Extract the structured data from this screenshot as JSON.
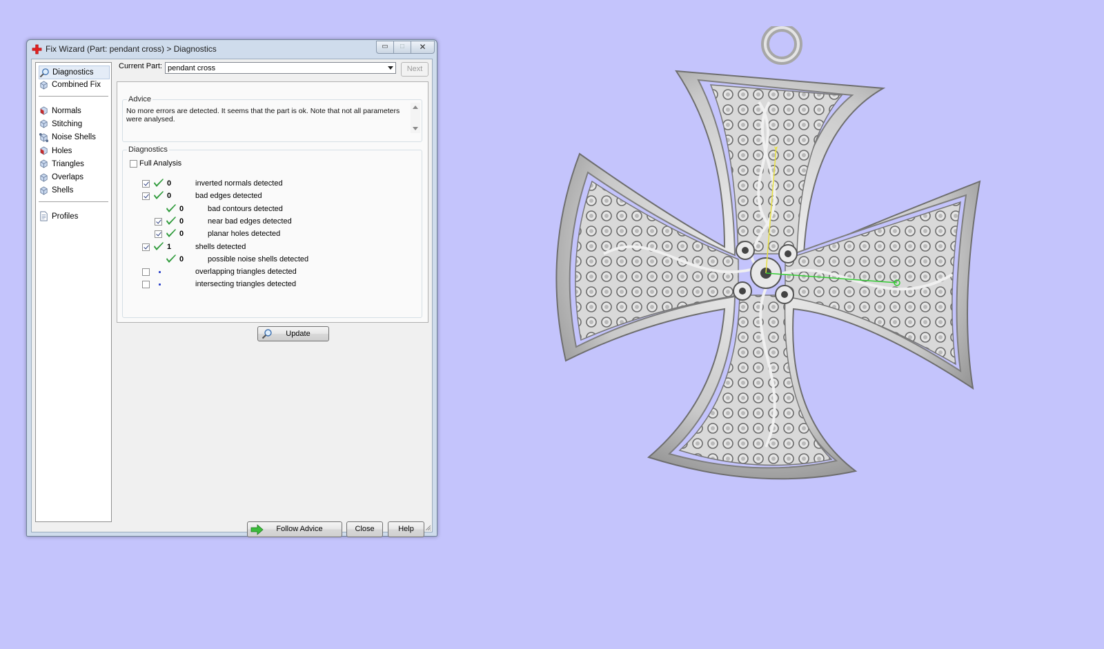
{
  "window": {
    "title": "Fix Wizard (Part: pendant cross) > Diagnostics",
    "controls": {
      "minimize": "▭",
      "maximize": "□",
      "close": "✕"
    }
  },
  "nav": {
    "groups": [
      [
        {
          "label": "Diagnostics",
          "icon": "magnifier-icon",
          "selected": true
        },
        {
          "label": "Combined Fix",
          "icon": "cube-icon"
        }
      ],
      [
        {
          "label": "Normals",
          "icon": "normals-cube-icon"
        },
        {
          "label": "Stitching",
          "icon": "stitching-cube-icon"
        },
        {
          "label": "Noise Shells",
          "icon": "noise-shells-icon"
        },
        {
          "label": "Holes",
          "icon": "holes-cube-icon"
        },
        {
          "label": "Triangles",
          "icon": "triangles-cube-icon"
        },
        {
          "label": "Overlaps",
          "icon": "overlaps-cube-icon"
        },
        {
          "label": "Shells",
          "icon": "shells-cube-icon"
        }
      ],
      [
        {
          "label": "Profiles",
          "icon": "document-icon"
        }
      ]
    ]
  },
  "current_part": {
    "label": "Current Part:",
    "value": "pendant cross",
    "next_label": "Next"
  },
  "advice": {
    "legend": "Advice",
    "text": "No more errors are detected. It seems that the part is ok. Note that not all parameters were analysed."
  },
  "diagnostics": {
    "legend": "Diagnostics",
    "full_analysis_label": "Full Analysis",
    "rows": [
      {
        "checkbox": true,
        "status": "ok",
        "count": "0",
        "label": "inverted normals detected",
        "indent": 0
      },
      {
        "checkbox": true,
        "status": "ok",
        "count": "0",
        "label": "bad edges detected",
        "indent": 0
      },
      {
        "checkbox": null,
        "status": "ok",
        "count": "0",
        "label": "bad contours detected",
        "indent": 1
      },
      {
        "checkbox": true,
        "status": "ok",
        "count": "0",
        "label": "near bad edges detected",
        "indent": 1
      },
      {
        "checkbox": true,
        "status": "ok",
        "count": "0",
        "label": "planar holes detected",
        "indent": 1
      },
      {
        "checkbox": true,
        "status": "ok",
        "count": "1",
        "label": "shells detected",
        "indent": 0
      },
      {
        "checkbox": null,
        "status": "ok",
        "count": "0",
        "label": "possible noise shells detected",
        "indent": 1
      },
      {
        "checkbox": false,
        "status": "none",
        "count": "",
        "label": "overlapping triangles detected",
        "indent": 0
      },
      {
        "checkbox": false,
        "status": "none",
        "count": "",
        "label": "intersecting triangles detected",
        "indent": 0
      }
    ],
    "update_label": "Update"
  },
  "footer": {
    "follow_label": "Follow Advice",
    "close_label": "Close",
    "help_label": "Help"
  },
  "colors": {
    "background": "#c4c4fc",
    "check_green": "#2e9a3a",
    "axis_yellow": "#e8e040",
    "axis_green": "#33cc33"
  }
}
